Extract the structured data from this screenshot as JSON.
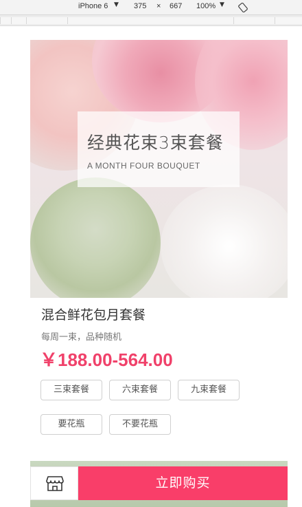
{
  "devtools": {
    "device": "iPhone 6",
    "width": "375",
    "times": "×",
    "height": "667",
    "zoom": "100%"
  },
  "hero": {
    "title": "经典花束3束套餐",
    "subtitle": "A MONTH FOUR BOUQUET"
  },
  "product": {
    "title": "混合鲜花包月套餐",
    "description": "每周一束，品种随机",
    "price": "￥188.00-564.00"
  },
  "options": {
    "packages": [
      "三束套餐",
      "六束套餐",
      "九束套餐"
    ],
    "vase": [
      "要花瓶",
      "不要花瓶"
    ]
  },
  "bottom_bar": {
    "buy_label": "立即购买"
  },
  "icons": {
    "shop": "storefront-icon",
    "rotate": "rotate-icon"
  }
}
